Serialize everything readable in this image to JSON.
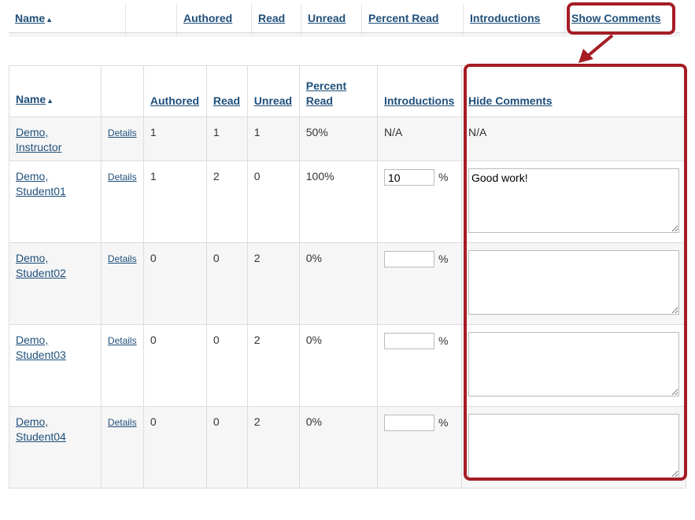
{
  "top_table": {
    "headers": [
      "Name",
      "",
      "Authored",
      "Read",
      "Unread",
      "Percent Read",
      "Introductions",
      "Show Comments"
    ]
  },
  "main_table": {
    "headers": {
      "name": "Name",
      "authored": "Authored",
      "read": "Read",
      "unread": "Unread",
      "percent_read_1": "Percent",
      "percent_read_2": "Read",
      "introductions": "Introductions",
      "comments": "Hide Comments"
    },
    "details_label": "Details",
    "percent_sign": "%",
    "rows": [
      {
        "name1": "Demo,",
        "name2": "Instructor",
        "authored": "1",
        "read": "1",
        "unread": "1",
        "percent": "50%",
        "intro": "N/A",
        "comment": "N/A",
        "editable": false
      },
      {
        "name1": "Demo,",
        "name2": "Student01",
        "authored": "1",
        "read": "2",
        "unread": "0",
        "percent": "100%",
        "intro": "10",
        "comment": "Good work!",
        "editable": true
      },
      {
        "name1": "Demo,",
        "name2": "Student02",
        "authored": "0",
        "read": "0",
        "unread": "2",
        "percent": "0%",
        "intro": "",
        "comment": "",
        "editable": true
      },
      {
        "name1": "Demo,",
        "name2": "Student03",
        "authored": "0",
        "read": "0",
        "unread": "2",
        "percent": "0%",
        "intro": "",
        "comment": "",
        "editable": true
      },
      {
        "name1": "Demo,",
        "name2": "Student04",
        "authored": "0",
        "read": "0",
        "unread": "2",
        "percent": "0%",
        "intro": "",
        "comment": "",
        "editable": true
      }
    ]
  },
  "colors": {
    "highlight": "#a51d24",
    "link": "#1f4f7a",
    "row_alt": "#f6f6f6"
  }
}
